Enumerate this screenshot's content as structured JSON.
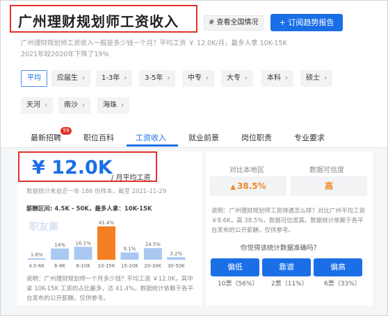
{
  "header": {
    "title": "广州理财规划师工资收入",
    "national_tag": "# 查看全国情况",
    "subscribe_button": "+ 订阅趋势报告"
  },
  "description": {
    "line1": "广州理财规划师工资收入一般是多少钱一个月？平均工资 ￥ 12.0K/月，最多人拿 10K-15K",
    "line2": "2021年较2020年下降了19%"
  },
  "filters": {
    "row1": [
      {
        "label": "平均",
        "active": true
      },
      {
        "label": "应届生"
      },
      {
        "label": "1-3年"
      },
      {
        "label": "3-5年"
      },
      {
        "label": "中专"
      },
      {
        "label": "大专"
      },
      {
        "label": "本科"
      },
      {
        "label": "硕士"
      }
    ],
    "row2": [
      {
        "label": "天河"
      },
      {
        "label": "南沙"
      },
      {
        "label": "海珠"
      }
    ]
  },
  "tabs": [
    {
      "label": "最新招聘",
      "badge": "59"
    },
    {
      "label": "职位百科"
    },
    {
      "label": "工资收入",
      "active": true
    },
    {
      "label": "就业前景"
    },
    {
      "label": "岗位职责"
    },
    {
      "label": "专业要求"
    }
  ],
  "salary": {
    "amount": "¥ 12.0K",
    "unit": "/ 月平均工资",
    "stats_line": "数据统计来自近一年 186 份样本，截至 2021-11-29",
    "range_line": "薪酬区间: 4.5K - 50K，最多人拿：10K-15K",
    "watermark": "职友集",
    "bottom_text": "说明：广州理财规划师一个月多少钱？平均工资 ￥12.0K，其中拿 10K-15K 工资的占比最多，达 41.4%，数据统计依赖于各平台发布的公开薪酬，仅供参考。"
  },
  "chart_data": {
    "type": "bar",
    "categories": [
      "4.5-6K",
      "6-8K",
      "8-10K",
      "10-15K",
      "15-20K",
      "20-30K",
      "30-50K"
    ],
    "values": [
      1.6,
      14,
      16.1,
      41.4,
      9.1,
      14.5,
      3.2
    ],
    "value_labels": [
      "1.6%",
      "14%",
      "16.1%",
      "41.4%",
      "9.1%",
      "14.5%",
      "3.2%"
    ],
    "highlight_index": 3,
    "colors": {
      "normal": "#a9c9f2",
      "highlight": "#f57e20"
    }
  },
  "comparison": {
    "local_label": "对比本地区",
    "local_value": "38.5%",
    "local_trend_icon": "arrow-up-icon",
    "reliability_label": "数据可信度",
    "reliability_value": "高",
    "note": "说明：广州理财规划师工资待遇怎么样？对比广州平均工资 ￥8.6K，高 38.5%，数据可信度高。数据统计依赖于各平台发布的公开薪酬，仅供参考。",
    "vote_question": "你觉得该统计数据准确吗？",
    "votes": [
      {
        "label": "偏低",
        "count": "10票（56%）"
      },
      {
        "label": "靠谱",
        "count": "2票（11%）"
      },
      {
        "label": "偏高",
        "count": "6票（33%）"
      }
    ]
  },
  "colors": {
    "brand_blue": "#1a6fe6",
    "alert_red": "#e0312a",
    "up_orange": "#f08a2a"
  }
}
